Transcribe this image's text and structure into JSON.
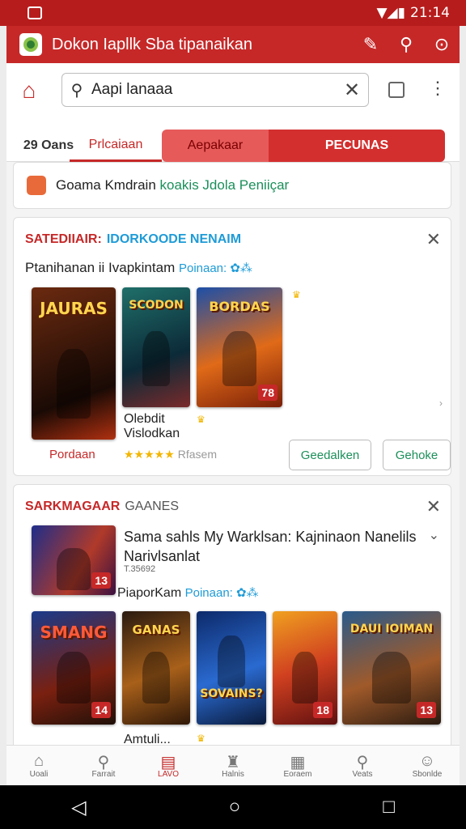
{
  "status": {
    "time": "21:14",
    "signal_icons": "▼◢▮"
  },
  "appbar": {
    "title": "Dokon Iapllk Sba tipanaikan",
    "icons": [
      "brush-icon",
      "search-icon",
      "settings-icon"
    ]
  },
  "search": {
    "value": "Aapi lanaaa",
    "placeholder": "Aapi lanaaa"
  },
  "tabs": [
    "29 Oans",
    "Prlcaiaan",
    "Aepakaar",
    "PECUNAS"
  ],
  "promo": {
    "text_main": "Goama Kmdrain",
    "text_green": "koakis Jdola Peniiçar"
  },
  "section1": {
    "head_red": "SATEDIIAIR:",
    "head_blue": "IDORKOODE NENAIM",
    "subtitle_main": "Ptanihanan ii Ivapkintam",
    "subtitle_blue": "Poinaan: ✿⁂",
    "covers": [
      {
        "title": "JAURAS",
        "badge": ""
      },
      {
        "title": "SCODON",
        "badge": ""
      },
      {
        "title": "BORDAS",
        "badge": "78"
      }
    ],
    "game_title": "Olebdit\nVislodkan",
    "left_link": "Pordaan",
    "stars": "★★★★★",
    "stars_text": "Rfasem",
    "btn_primary": "Geedalken",
    "btn_secondary": "Gehoke"
  },
  "section2": {
    "head_red": "SARKMAGAAR",
    "head_grey": "GAANES",
    "featured_title": "Sama sahls My Warklsan: Kajninaon Nanelils Narivlsanlat",
    "small_text": "T.35692",
    "sub2_main": "PiaporKam",
    "sub2_blue": "Poinaan: ✿⁂",
    "featured_badge": "13",
    "covers": [
      {
        "title": "SMANG",
        "badge": "14"
      },
      {
        "title": "GANAS",
        "badge": ""
      },
      {
        "title": "SOVAINS?",
        "badge": ""
      },
      {
        "title": "",
        "badge": "18"
      },
      {
        "title": "DAUI IOIMAN",
        "badge": "13"
      }
    ],
    "bottom_label": "Amtuli..."
  },
  "bottomnav": [
    {
      "label": "Uoali",
      "icon": "⌂"
    },
    {
      "label": "Farrait",
      "icon": "⚲"
    },
    {
      "label": "LAVO",
      "icon": "▤"
    },
    {
      "label": "Halnis",
      "icon": "♜"
    },
    {
      "label": "Eoraem",
      "icon": "▦"
    },
    {
      "label": "Veats",
      "icon": "⚲"
    },
    {
      "label": "Sbonlde",
      "icon": "☺"
    }
  ],
  "colors": {
    "primary": "#c62828",
    "accent_green": "#1b8f5a",
    "accent_blue": "#1e9bd7"
  }
}
